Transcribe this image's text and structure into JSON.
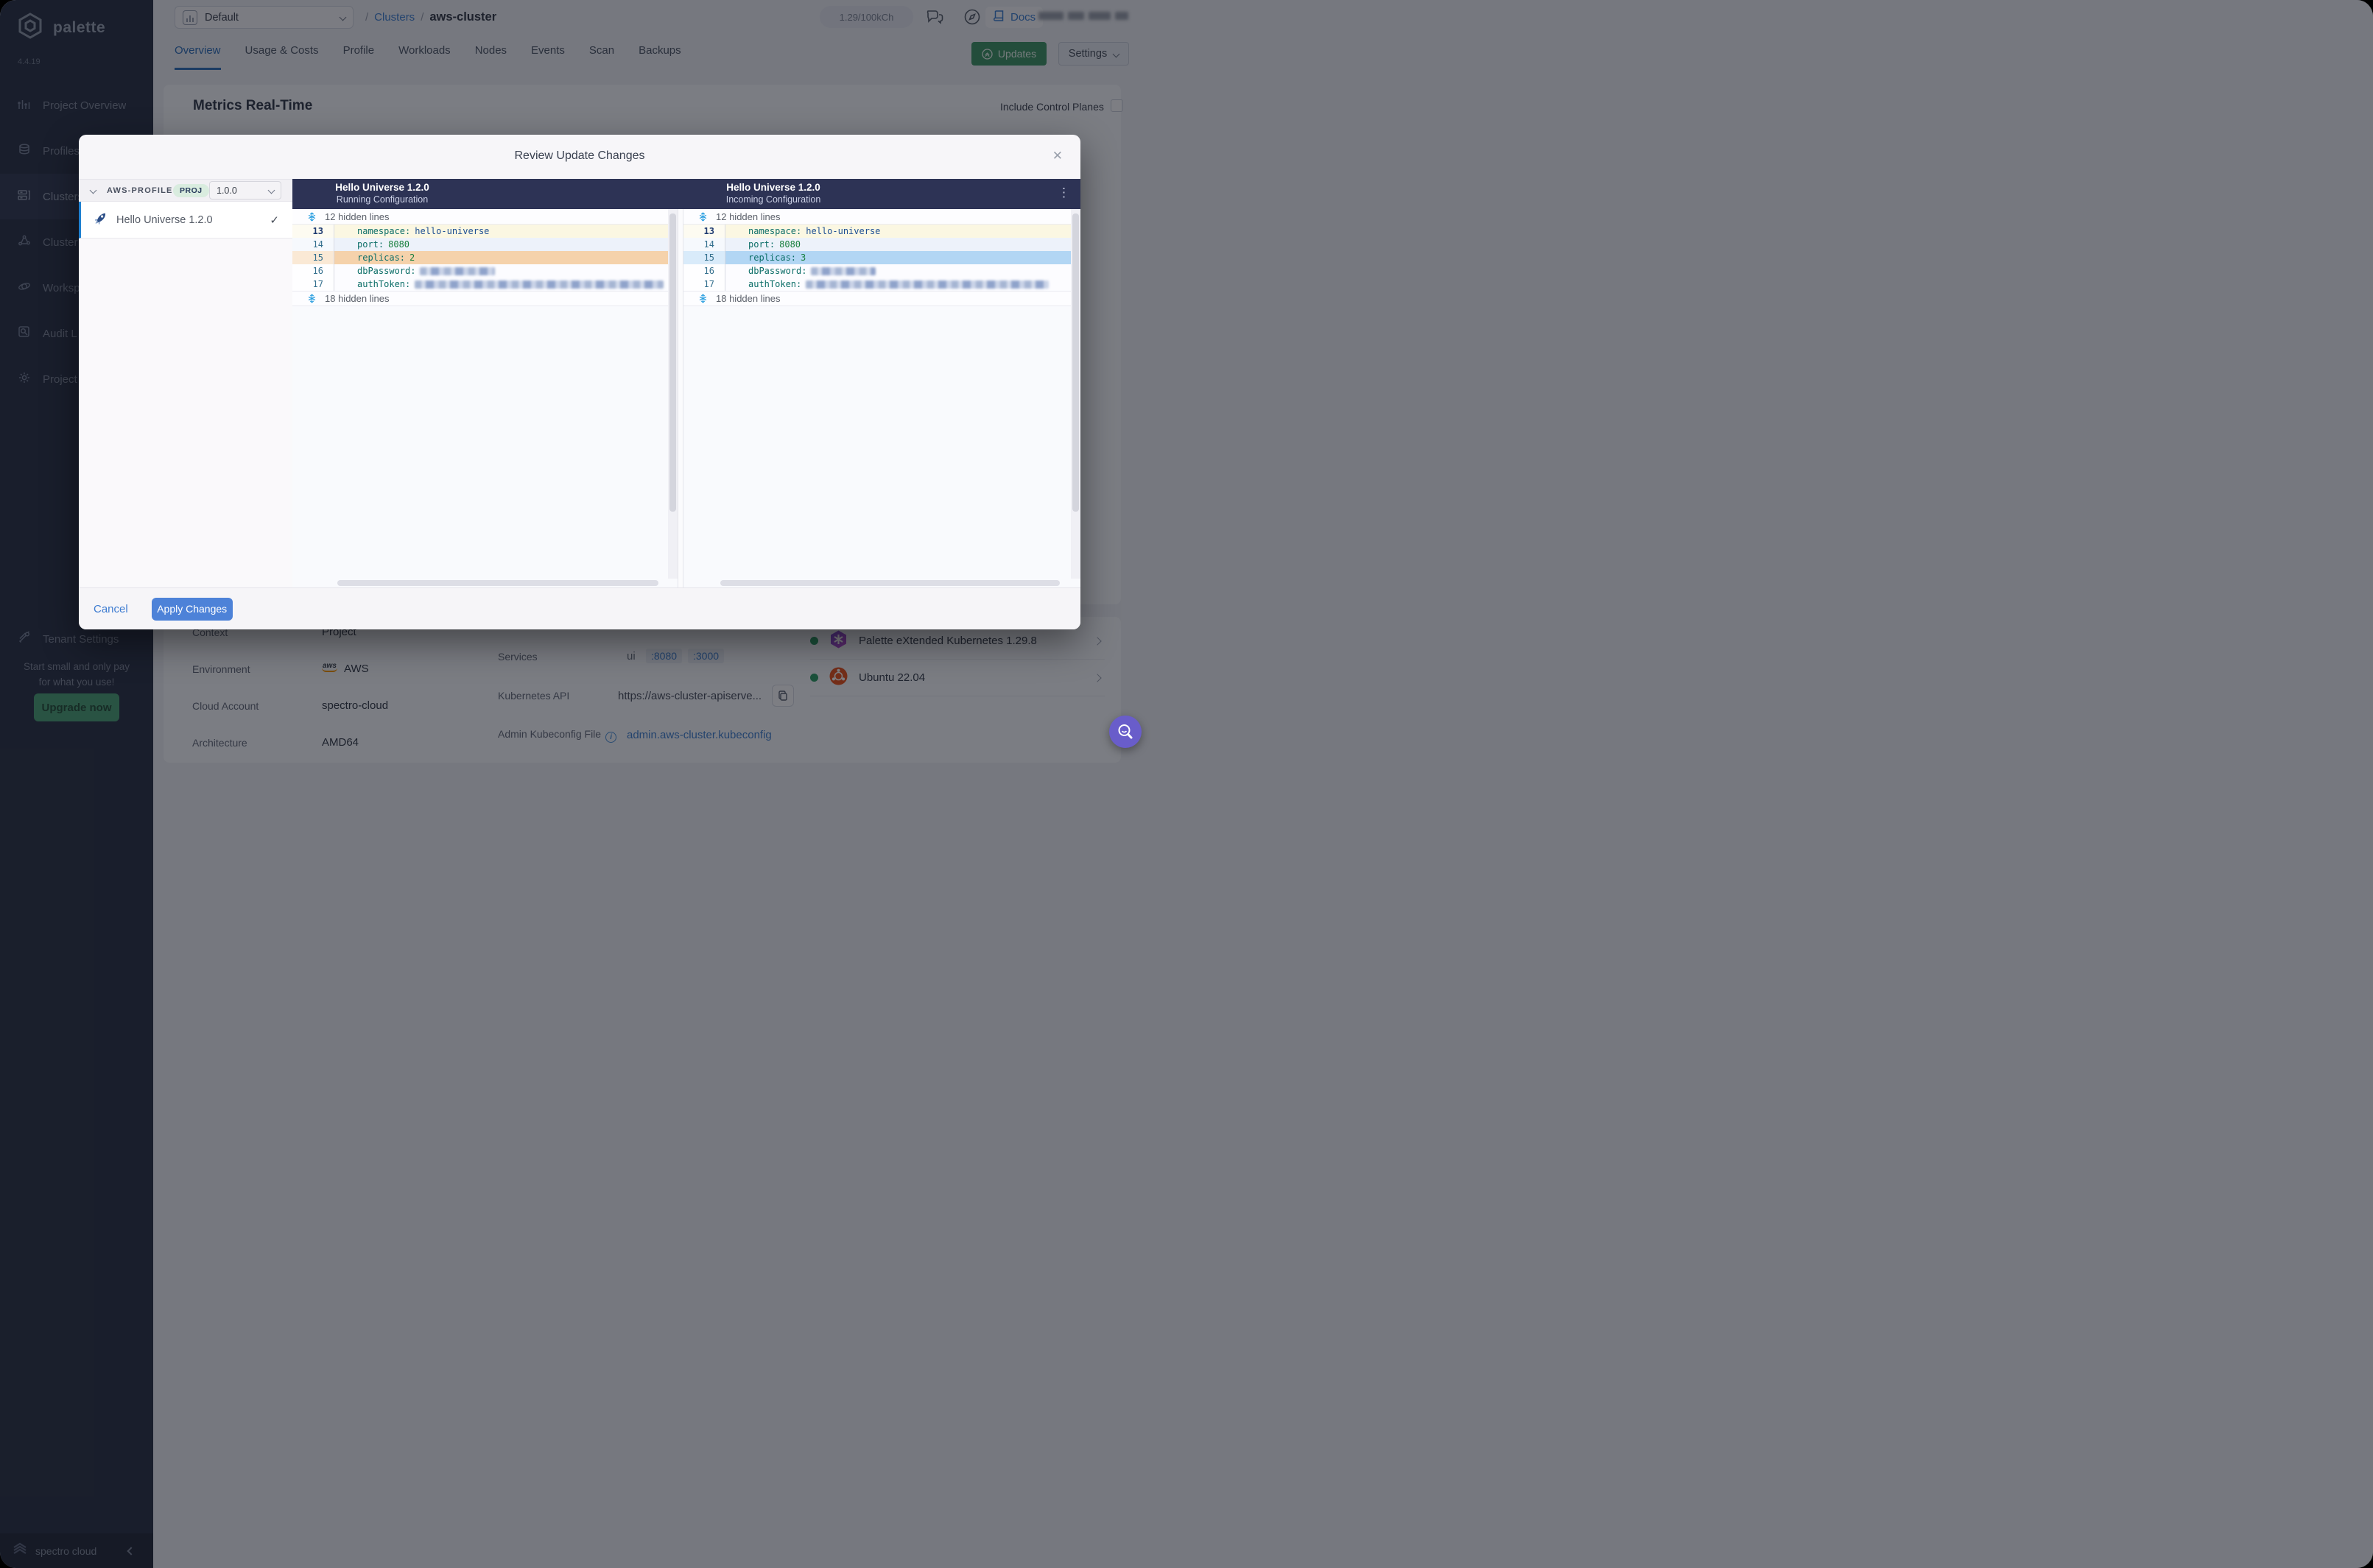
{
  "brand": {
    "name": "palette",
    "version": "4.4.19",
    "footer": "spectro cloud"
  },
  "sidebar": {
    "items": [
      {
        "label": "Project Overview",
        "icon": "bar-chart"
      },
      {
        "label": "Profiles",
        "icon": "layers"
      },
      {
        "label": "Clusters",
        "icon": "servers"
      },
      {
        "label": "Cluster",
        "icon": "nodes"
      },
      {
        "label": "Worksp",
        "icon": "orbit"
      },
      {
        "label": "Audit L",
        "icon": "audit"
      },
      {
        "label": "Project",
        "icon": "gear"
      }
    ],
    "tenant": {
      "label": "Tenant Settings",
      "icon": "tools"
    },
    "promo": {
      "line1": "Start small and only pay",
      "line2": "for what you use!",
      "cta": "Upgrade now"
    }
  },
  "topbar": {
    "project_selector": "Default",
    "breadcrumb": {
      "sep": "/",
      "section": "Clusters",
      "current": "aws-cluster"
    },
    "usage": "1.29/100kCh",
    "docs": "Docs"
  },
  "cluster_header": {
    "tabs": [
      "Overview",
      "Usage & Costs",
      "Profile",
      "Workloads",
      "Nodes",
      "Events",
      "Scan",
      "Backups"
    ],
    "active_tab": "Overview",
    "updates": "Updates",
    "settings": "Settings"
  },
  "content": {
    "metrics_title": "Metrics Real-Time",
    "include_control_planes": "Include Control Planes",
    "details": [
      {
        "label": "Context",
        "value": "Project"
      },
      {
        "label": "Environment",
        "value": "AWS"
      },
      {
        "label": "Cloud Account",
        "value": "spectro-cloud"
      },
      {
        "label": "Architecture",
        "value": "AMD64"
      }
    ],
    "services": {
      "label": "Services",
      "name": "ui",
      "ports": [
        ":8080",
        ":3000"
      ]
    },
    "k8s_api": {
      "label": "Kubernetes API",
      "value": "https://aws-cluster-apiserve..."
    },
    "kubeconfig": {
      "label": "Admin Kubeconfig File",
      "value": "admin.aws-cluster.kubeconfig"
    },
    "packs": [
      {
        "name": "Palette eXtended Kubernetes 1.29.8",
        "icon": "pek-hexagon",
        "status": "healthy"
      },
      {
        "name": "Ubuntu 22.04",
        "icon": "ubuntu",
        "status": "healthy"
      }
    ]
  },
  "modal": {
    "title": "Review Update Changes",
    "profile_row": {
      "name": "AWS-PROFILE",
      "scope": "PROJ",
      "version": "1.0.0"
    },
    "profile_item": {
      "label": "Hello Universe 1.2.0",
      "icon": "rocket",
      "selected": true
    },
    "diff": {
      "left_panel": {
        "title": "Hello Universe 1.2.0",
        "subtitle": "Running Configuration"
      },
      "right_panel": {
        "title": "Hello Universe 1.2.0",
        "subtitle": "Incoming Configuration"
      },
      "hidden_top": "12 hidden lines",
      "hidden_bottom": "18 hidden lines",
      "left_lines": [
        {
          "no": "13",
          "key": "namespace:",
          "value": "hello-universe"
        },
        {
          "no": "14",
          "key": "port:",
          "value": "8080"
        },
        {
          "no": "15",
          "key": "replicas:",
          "value": "2"
        },
        {
          "no": "16",
          "key": "dbPassword:",
          "value": ""
        },
        {
          "no": "17",
          "key": "authToken:",
          "value": ""
        }
      ],
      "right_lines": [
        {
          "no": "13",
          "key": "namespace:",
          "value": "hello-universe"
        },
        {
          "no": "14",
          "key": "port:",
          "value": "8080"
        },
        {
          "no": "15",
          "key": "replicas:",
          "value": "3"
        },
        {
          "no": "16",
          "key": "dbPassword:",
          "value": ""
        },
        {
          "no": "17",
          "key": "authToken:",
          "value": "'"
        }
      ]
    },
    "footer": {
      "cancel": "Cancel",
      "apply": "Apply Changes"
    }
  },
  "colors": {
    "accent_blue": "#4d82d8",
    "diff_header_navy": "#2d3355",
    "removed_highlight": "#f5d2ab",
    "added_highlight": "#b2d6f4",
    "updates_green": "#3f9468",
    "fab_purple": "#695dca",
    "sidebar_navy": "#2b3347"
  }
}
